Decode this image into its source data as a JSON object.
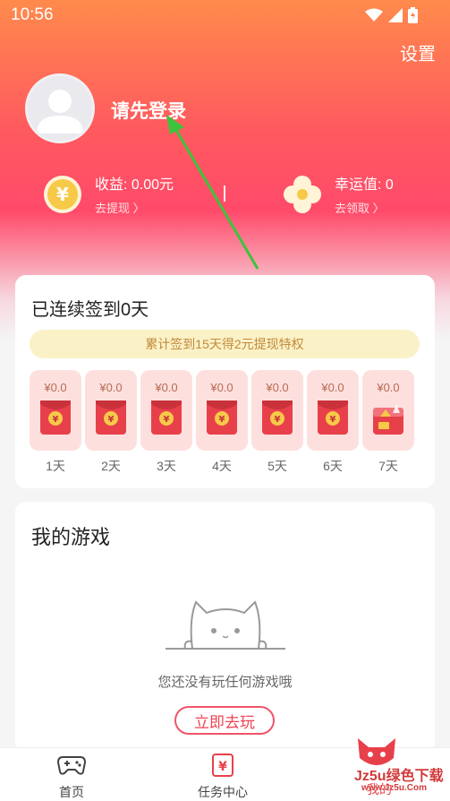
{
  "status_bar": {
    "time": "10:56"
  },
  "header": {
    "settings_label": "设置",
    "login_label": "请先登录",
    "earnings": {
      "label": "收益: 0.00元",
      "action": "去提现 〉"
    },
    "luck": {
      "label": "幸运值: 0",
      "action": "去领取 〉"
    }
  },
  "sign_in": {
    "title": "已连续签到0天",
    "banner": "累计签到15天得2元提现特权",
    "days": [
      {
        "amount": "¥0.0",
        "label": "1天"
      },
      {
        "amount": "¥0.0",
        "label": "2天"
      },
      {
        "amount": "¥0.0",
        "label": "3天"
      },
      {
        "amount": "¥0.0",
        "label": "4天"
      },
      {
        "amount": "¥0.0",
        "label": "5天"
      },
      {
        "amount": "¥0.0",
        "label": "6天"
      },
      {
        "amount": "¥0.0",
        "label": "7天"
      }
    ]
  },
  "my_games": {
    "title": "我的游戏",
    "empty_text": "您还没有玩任何游戏哦",
    "play_button": "立即去玩"
  },
  "tabbar": {
    "home": "首页",
    "tasks": "任务中心",
    "mine": "我的"
  },
  "watermark": {
    "line1": "Jz5u绿色下载",
    "line2": "www.Jz5u.Com"
  },
  "colors": {
    "accent": "#ff4a6a",
    "gold": "#f7c948",
    "banner_bg": "#fbf1c6",
    "day_bg": "#fde0de"
  }
}
